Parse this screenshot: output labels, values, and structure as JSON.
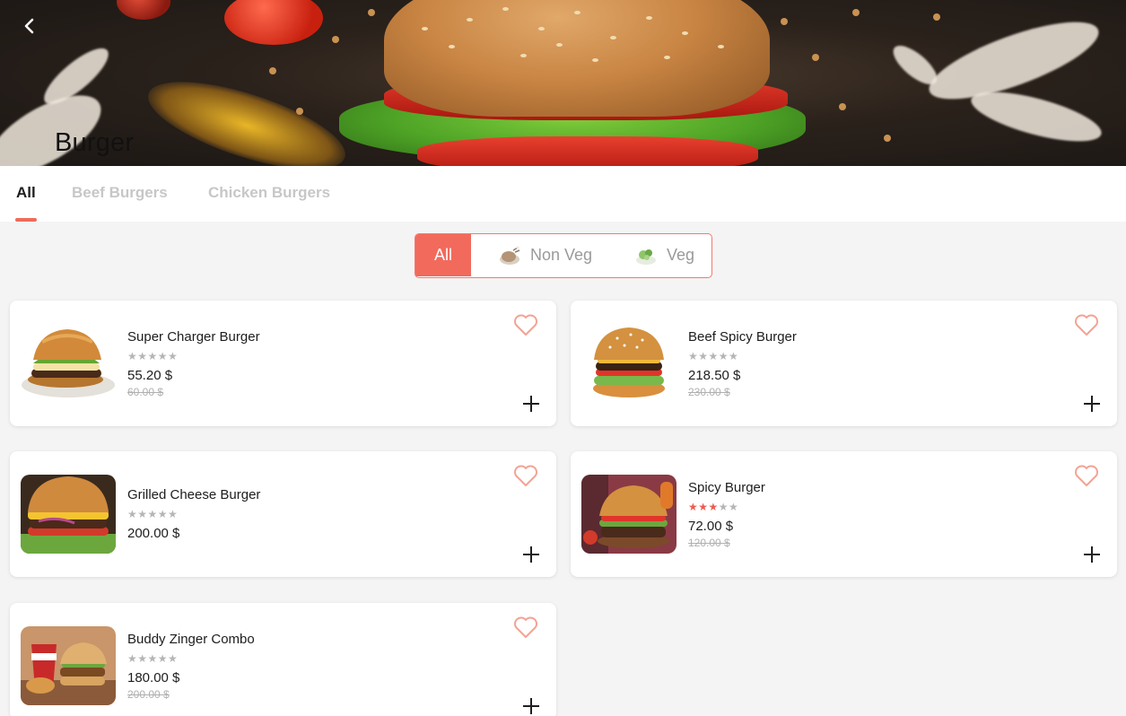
{
  "header": {
    "title": "Burger",
    "back_icon": "chevron-left-icon"
  },
  "tabs": [
    {
      "label": "All",
      "active": true
    },
    {
      "label": "Beef Burgers",
      "active": false
    },
    {
      "label": "Chicken Burgers",
      "active": false
    }
  ],
  "filter": {
    "options": [
      {
        "label": "All",
        "selected": true
      },
      {
        "label": "Non Veg",
        "icon": "chicken-icon",
        "selected": false
      },
      {
        "label": "Veg",
        "icon": "salad-icon",
        "selected": false
      }
    ]
  },
  "colors": {
    "accent": "#f26a5c",
    "star_on": "#ee5b4e",
    "star_off": "#b5b5b5"
  },
  "products": [
    {
      "name": "Super Charger Burger",
      "rating": 0,
      "price": "55.20 $",
      "old_price": "60.00 $"
    },
    {
      "name": "Beef Spicy Burger",
      "rating": 0,
      "price": "218.50 $",
      "old_price": "230.00 $"
    },
    {
      "name": "Grilled Cheese Burger",
      "rating": 0,
      "price": "200.00 $",
      "old_price": ""
    },
    {
      "name": "Spicy Burger",
      "rating": 3,
      "price": "72.00 $",
      "old_price": "120.00 $"
    },
    {
      "name": "Buddy Zinger Combo",
      "rating": 0,
      "price": "180.00 $",
      "old_price": "200.00 $"
    }
  ]
}
